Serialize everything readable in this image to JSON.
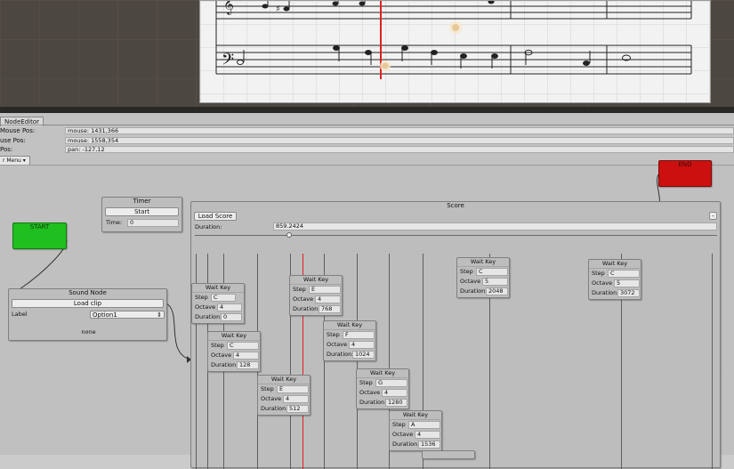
{
  "editor": {
    "tab_label": "NodeEditor",
    "info": [
      {
        "label": "Mouse Pos:",
        "value": "mouse: 1431,366"
      },
      {
        "label": "use Pos:",
        "value": "mouse: 1558,354"
      },
      {
        "label": "Pos:",
        "value": "pan: -127,12"
      }
    ],
    "menu_label": "r Menu"
  },
  "nodes": {
    "start_label": "START",
    "end_label": "END",
    "timer": {
      "title": "Timer",
      "start_button": "Start",
      "time_label": "Time:",
      "time_value": "0"
    },
    "sound": {
      "title": "Sound Node",
      "load_button": "Load clip",
      "label_text": "Label",
      "option_value": "Option1",
      "status": "none"
    },
    "score": {
      "title": "Score",
      "load_button": "Load Score",
      "minus_button": "-",
      "duration_label": "Duration:",
      "duration_value": "859.2424",
      "slider_fraction": 0.18
    },
    "wait_key_title": "Wait Key",
    "row_labels": {
      "step": "Step",
      "octave": "Octave",
      "duration": "Duration"
    },
    "wait_keys": [
      {
        "step": "C",
        "octave": "4",
        "duration": "0"
      },
      {
        "step": "C",
        "octave": "4",
        "duration": "128"
      },
      {
        "step": "E",
        "octave": "4",
        "duration": "512"
      },
      {
        "step": "E",
        "octave": "4",
        "duration": "768"
      },
      {
        "step": "F",
        "octave": "4",
        "duration": "1024"
      },
      {
        "step": "G",
        "octave": "4",
        "duration": "1280"
      },
      {
        "step": "A",
        "octave": "4",
        "duration": "1536"
      },
      {
        "step": "C",
        "octave": "5",
        "duration": "2048"
      },
      {
        "step": "C",
        "octave": "5",
        "duration": "3072"
      }
    ]
  },
  "colors": {
    "start": "#1fbf1f",
    "end": "#cc1010",
    "playhead": "#e02020"
  }
}
